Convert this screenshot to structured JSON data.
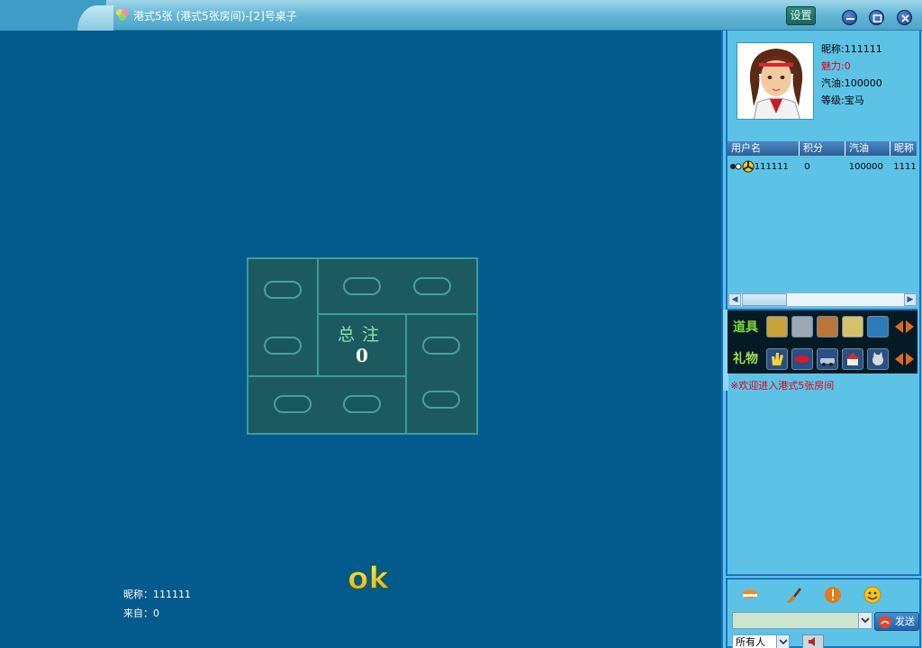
{
  "window": {
    "title": "港式5张 (港式5张房间)-[2]号桌子",
    "settings_label": "设置"
  },
  "board": {
    "pot_label": "总注",
    "pot_value": "0"
  },
  "ok_label": "ok",
  "player": {
    "nickname_line": "昵称：111111",
    "from_line": "来自：0"
  },
  "profile": {
    "nickname": "昵称:111111",
    "charm": "魅力:0",
    "fuel": "汽油:100000",
    "level": "等级:宝马"
  },
  "user_table": {
    "headers": [
      "用户名",
      "积分",
      "汽油",
      "昵称"
    ],
    "rows": [
      {
        "username": "111111",
        "score": "0",
        "fuel": "100000",
        "nickname": "1111"
      }
    ]
  },
  "items_bar": {
    "props_label": "道具",
    "gifts_label": "礼物"
  },
  "chat": {
    "welcome": "※欢迎进入港式5张房间",
    "send_label": "发送",
    "target": "所有人"
  },
  "colors": {
    "background": "#035a8c",
    "panel": "#5cc3e6",
    "accent_red": "#e0001b"
  }
}
